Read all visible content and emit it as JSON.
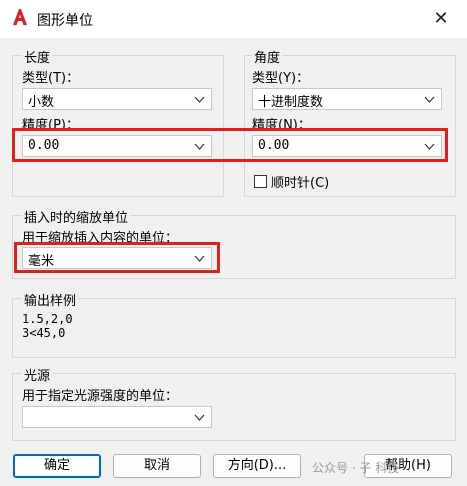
{
  "window": {
    "title": "图形单位",
    "close_glyph": "✕"
  },
  "length": {
    "group_label": "长度",
    "type_label": "类型(T)：",
    "type_value": "小数",
    "precision_label": "精度(P)：",
    "precision_value": "0.00"
  },
  "angle": {
    "group_label": "角度",
    "type_label": "类型(Y)：",
    "type_value": "十进制度数",
    "precision_label": "精度(N)：",
    "precision_value": "0.00",
    "clockwise_label": "顺时针(C)",
    "clockwise_checked": false
  },
  "insertion": {
    "group_label": "插入时的缩放单位",
    "units_label": "用于缩放插入内容的单位：",
    "units_value": "毫米"
  },
  "sample": {
    "group_label": "输出样例",
    "line1": "1.5,2,0",
    "line2": "3<45,0"
  },
  "lighting": {
    "group_label": "光源",
    "units_label": "用于指定光源强度的单位：",
    "units_value": ""
  },
  "buttons": {
    "ok": "确定",
    "cancel": "取消",
    "direction": "方向(D)...",
    "help": "帮助(H)"
  },
  "watermark": "公众号 · 子  科技",
  "colors": {
    "highlight": "#e0211b",
    "accent": "#0067c0",
    "app_icon": "#d8232a"
  }
}
